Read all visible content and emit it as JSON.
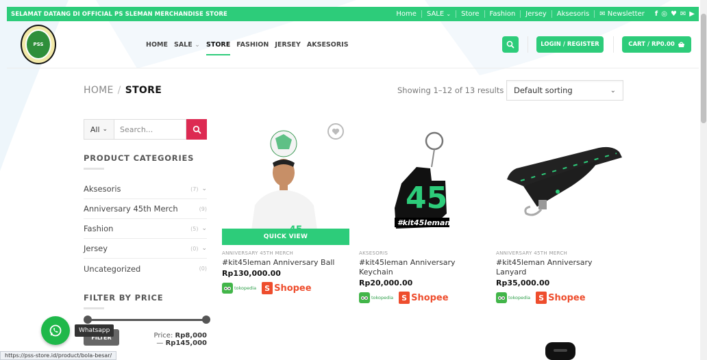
{
  "topbar": {
    "welcome": "SELAMAT DATANG DI OFFICIAL PS SLEMAN MERCHANDISE STORE",
    "nav": [
      "Home",
      "SALE",
      "Store",
      "Fashion",
      "Jersey",
      "Aksesoris"
    ],
    "newsletter": "Newsletter",
    "social_icons": [
      "facebook-icon",
      "instagram-icon",
      "twitter-icon",
      "mail-icon",
      "youtube-icon"
    ]
  },
  "header": {
    "logo_text": "PSS",
    "nav": [
      "HOME",
      "SALE",
      "STORE",
      "FASHION",
      "JERSEY",
      "AKSESORIS"
    ],
    "active_nav": "STORE",
    "login_label": "LOGIN / REGISTER",
    "cart_label": "CART / RP0.00"
  },
  "breadcrumb": {
    "home": "HOME",
    "sep": "/",
    "current": "STORE"
  },
  "results_text": "Showing 1–12 of 13 results",
  "sorting": {
    "selected": "Default sorting"
  },
  "sidebar": {
    "search": {
      "category": "All",
      "placeholder": "Search..."
    },
    "categories_title": "PRODUCT CATEGORIES",
    "categories": [
      {
        "name": "Aksesoris",
        "count": "(7)"
      },
      {
        "name": "Anniversary 45th Merch",
        "count": "(9)"
      },
      {
        "name": "Fashion",
        "count": "(5)"
      },
      {
        "name": "Jersey",
        "count": "(0)"
      },
      {
        "name": "Uncategorized",
        "count": "(0)"
      }
    ],
    "price_title": "FILTER BY PRICE",
    "filter_label": "FILTER",
    "price_label": "Price:",
    "price_min": "Rp8,000",
    "price_max": "Rp145,000"
  },
  "products": [
    {
      "category": "ANNIVERSARY 45TH MERCH",
      "title": "#kit45leman Anniversary Ball",
      "price": "Rp130,000.00",
      "quick_view": "QUICK VIEW"
    },
    {
      "category": "AKSESORIS",
      "title": "#kit45leman Anniversary Keychain",
      "price": "Rp20,000.00"
    },
    {
      "category": "ANNIVERSARY 45TH MERCH",
      "title": "#kit45leman Anniversary Lanyard",
      "price": "Rp35,000.00"
    }
  ],
  "stores": {
    "tokopedia": "tokopedia",
    "shopee": "Shopee"
  },
  "whatsapp": {
    "label": "Whatsapp"
  },
  "status_url": "https://pss-store.id/product/bola-besar/",
  "colors": {
    "accent": "#2dcc7a",
    "search_red": "#dd2a52",
    "shopee": "#ee4d2d"
  }
}
